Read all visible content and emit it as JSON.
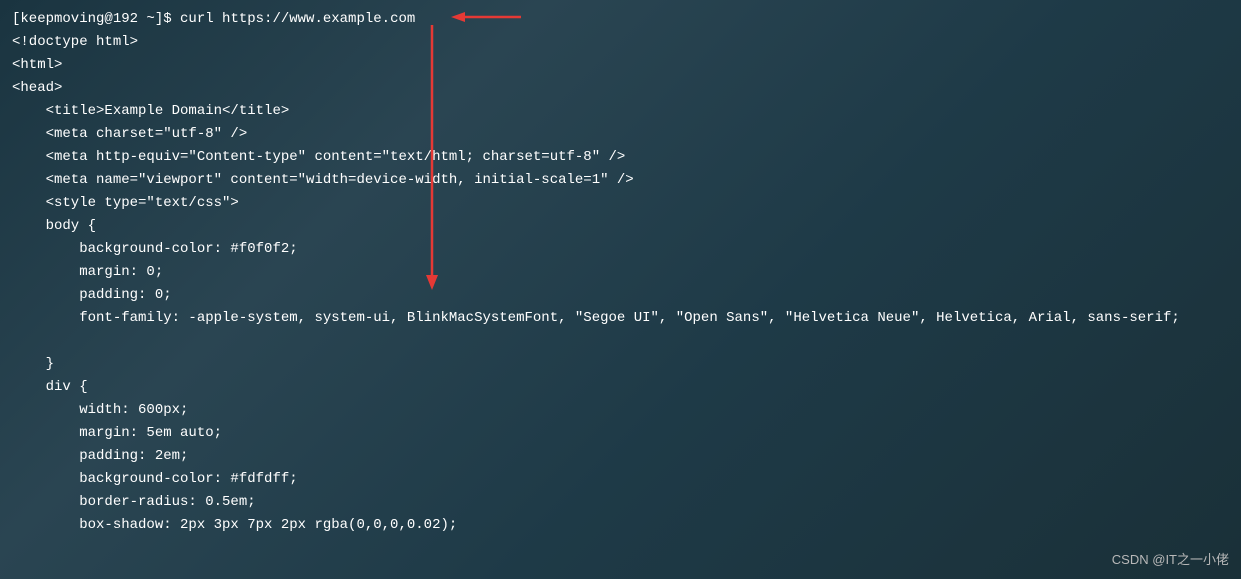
{
  "terminal": {
    "prompt": "[keepmoving@192 ~]$ ",
    "command": "curl https://www.example.com",
    "output": [
      "<!doctype html>",
      "<html>",
      "<head>",
      "    <title>Example Domain</title>",
      "",
      "    <meta charset=\"utf-8\" />",
      "    <meta http-equiv=\"Content-type\" content=\"text/html; charset=utf-8\" />",
      "    <meta name=\"viewport\" content=\"width=device-width, initial-scale=1\" />",
      "    <style type=\"text/css\">",
      "    body {",
      "        background-color: #f0f0f2;",
      "        margin: 0;",
      "        padding: 0;",
      "        font-family: -apple-system, system-ui, BlinkMacSystemFont, \"Segoe UI\", \"Open Sans\", \"Helvetica Neue\", Helvetica, Arial, sans-serif;",
      "        ",
      "    }",
      "    div {",
      "        width: 600px;",
      "        margin: 5em auto;",
      "        padding: 2em;",
      "        background-color: #fdfdff;",
      "        border-radius: 0.5em;",
      "        box-shadow: 2px 3px 7px 2px rgba(0,0,0,0.02);"
    ]
  },
  "watermark": "CSDN @IT之一小佬",
  "annotations": {
    "arrow_color": "#e53935"
  }
}
